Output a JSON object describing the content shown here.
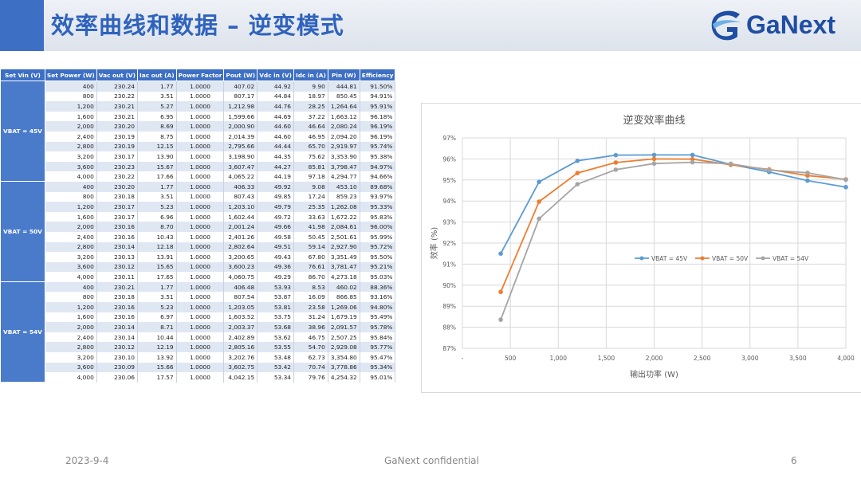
{
  "header": {
    "title": "效率曲线和数据 – 逆变模式",
    "logo_text": "GaNext",
    "accent_color": "#3d6fc4",
    "title_color": "#2f63bd"
  },
  "table": {
    "headers": [
      "Set Vin (V)",
      "Set Power (W)",
      "Vac out (V)",
      "Iac out (A)",
      "Power Factor",
      "Pout (W)",
      "Vdc in (V)",
      "Idc in (A)",
      "Pin (W)",
      "Efficiency"
    ],
    "groups": [
      {
        "label": "VBAT = 45V",
        "rows": [
          [
            "400",
            "230.24",
            "1.77",
            "1.0000",
            "407.02",
            "44.92",
            "9.90",
            "444.81",
            "91.50%"
          ],
          [
            "800",
            "230.22",
            "3.51",
            "1.0000",
            "807.17",
            "44.84",
            "18.97",
            "850.45",
            "94.91%"
          ],
          [
            "1,200",
            "230.21",
            "5.27",
            "1.0000",
            "1,212.98",
            "44.76",
            "28.25",
            "1,264.64",
            "95.91%"
          ],
          [
            "1,600",
            "230.21",
            "6.95",
            "1.0000",
            "1,599.66",
            "44.69",
            "37.22",
            "1,663.12",
            "96.18%"
          ],
          [
            "2,000",
            "230.20",
            "8.69",
            "1.0000",
            "2,000.90",
            "44.60",
            "46.64",
            "2,080.24",
            "96.19%"
          ],
          [
            "2,400",
            "230.19",
            "8.75",
            "1.0000",
            "2,014.39",
            "44.60",
            "46.95",
            "2,094.20",
            "96.19%"
          ],
          [
            "2,800",
            "230.19",
            "12.15",
            "1.0000",
            "2,795.66",
            "44.44",
            "65.70",
            "2,919.97",
            "95.74%"
          ],
          [
            "3,200",
            "230.17",
            "13.90",
            "1.0000",
            "3,198.90",
            "44.35",
            "75.62",
            "3,353.90",
            "95.38%"
          ],
          [
            "3,600",
            "230.23",
            "15.67",
            "1.0000",
            "3,607.47",
            "44.27",
            "85.81",
            "3,798.47",
            "94.97%"
          ],
          [
            "4,000",
            "230.22",
            "17.66",
            "1.0000",
            "4,065.22",
            "44.19",
            "97.18",
            "4,294.77",
            "94.66%"
          ]
        ]
      },
      {
        "label": "VBAT = 50V",
        "rows": [
          [
            "400",
            "230.20",
            "1.77",
            "1.0000",
            "406.33",
            "49.92",
            "9.08",
            "453.10",
            "89.68%"
          ],
          [
            "800",
            "230.18",
            "3.51",
            "1.0000",
            "807.43",
            "49.85",
            "17.24",
            "859.23",
            "93.97%"
          ],
          [
            "1,200",
            "230.17",
            "5.23",
            "1.0000",
            "1,203.10",
            "49.79",
            "25.35",
            "1,262.08",
            "95.33%"
          ],
          [
            "1,600",
            "230.17",
            "6.96",
            "1.0000",
            "1,602.44",
            "49.72",
            "33.63",
            "1,672.22",
            "95.83%"
          ],
          [
            "2,000",
            "230.16",
            "8.70",
            "1.0000",
            "2,001.24",
            "49.66",
            "41.98",
            "2,084.61",
            "96.00%"
          ],
          [
            "2,400",
            "230.16",
            "10.43",
            "1.0000",
            "2,401.26",
            "49.58",
            "50.45",
            "2,501.61",
            "95.99%"
          ],
          [
            "2,800",
            "230.14",
            "12.18",
            "1.0000",
            "2,802.64",
            "49.51",
            "59.14",
            "2,927.90",
            "95.72%"
          ],
          [
            "3,200",
            "230.13",
            "13.91",
            "1.0000",
            "3,200.65",
            "49.43",
            "67.80",
            "3,351.49",
            "95.50%"
          ],
          [
            "3,600",
            "230.12",
            "15.65",
            "1.0000",
            "3,600.23",
            "49.36",
            "76.61",
            "3,781.47",
            "95.21%"
          ],
          [
            "4,000",
            "230.11",
            "17.65",
            "1.0000",
            "4,060.75",
            "49.29",
            "86.70",
            "4,273.18",
            "95.03%"
          ]
        ]
      },
      {
        "label": "VBAT = 54V",
        "rows": [
          [
            "400",
            "230.21",
            "1.77",
            "1.0000",
            "406.48",
            "53.93",
            "8.53",
            "460.02",
            "88.36%"
          ],
          [
            "800",
            "230.18",
            "3.51",
            "1.0000",
            "807.54",
            "53.87",
            "16.09",
            "866.85",
            "93.16%"
          ],
          [
            "1,200",
            "230.16",
            "5.23",
            "1.0000",
            "1,203.05",
            "53.81",
            "23.58",
            "1,269.06",
            "94.80%"
          ],
          [
            "1,600",
            "230.16",
            "6.97",
            "1.0000",
            "1,603.52",
            "53.75",
            "31.24",
            "1,679.19",
            "95.49%"
          ],
          [
            "2,000",
            "230.14",
            "8.71",
            "1.0000",
            "2,003.37",
            "53.68",
            "38.96",
            "2,091.57",
            "95.78%"
          ],
          [
            "2,400",
            "230.14",
            "10.44",
            "1.0000",
            "2,402.89",
            "53.62",
            "46.75",
            "2,507.25",
            "95.84%"
          ],
          [
            "2,800",
            "230.12",
            "12.19",
            "1.0000",
            "2,805.16",
            "53.55",
            "54.70",
            "2,929.08",
            "95.77%"
          ],
          [
            "3,200",
            "230.10",
            "13.92",
            "1.0000",
            "3,202.76",
            "53.48",
            "62.73",
            "3,354.80",
            "95.47%"
          ],
          [
            "3,600",
            "230.09",
            "15.66",
            "1.0000",
            "3,602.75",
            "53.42",
            "70.74",
            "3,778.86",
            "95.34%"
          ],
          [
            "4,000",
            "230.06",
            "17.57",
            "1.0000",
            "4,042.15",
            "53.34",
            "79.76",
            "4,254.32",
            "95.01%"
          ]
        ]
      }
    ]
  },
  "chart_data": {
    "type": "line",
    "title": "逆变效率曲线",
    "xlabel": "输出功率 (W)",
    "ylabel": "效率 (%)",
    "x": [
      400,
      800,
      1200,
      1600,
      2000,
      2400,
      2800,
      3200,
      3600,
      4000
    ],
    "xlim": [
      0,
      4000
    ],
    "ylim": [
      87,
      97
    ],
    "x_ticks": [
      "-",
      "500",
      "1,000",
      "1,500",
      "2,000",
      "2,500",
      "3,000",
      "3,500",
      "4,000"
    ],
    "y_ticks": [
      "87%",
      "88%",
      "89%",
      "90%",
      "91%",
      "92%",
      "93%",
      "94%",
      "95%",
      "96%",
      "97%"
    ],
    "grid": true,
    "legend_position": "right-middle",
    "series": [
      {
        "name": "VBAT = 45V",
        "color": "#5b9bd5",
        "values": [
          91.5,
          94.91,
          95.91,
          96.18,
          96.19,
          96.19,
          95.74,
          95.38,
          94.97,
          94.66
        ]
      },
      {
        "name": "VBAT = 50V",
        "color": "#ed7d31",
        "values": [
          89.68,
          93.97,
          95.33,
          95.83,
          96.0,
          95.99,
          95.72,
          95.5,
          95.21,
          95.03
        ]
      },
      {
        "name": "VBAT = 54V",
        "color": "#a5a5a5",
        "values": [
          88.36,
          93.16,
          94.8,
          95.49,
          95.78,
          95.84,
          95.77,
          95.47,
          95.34,
          95.01
        ]
      }
    ]
  },
  "footer": {
    "date": "2023-9-4",
    "confidential": "GaNext confidential",
    "page": "6"
  }
}
